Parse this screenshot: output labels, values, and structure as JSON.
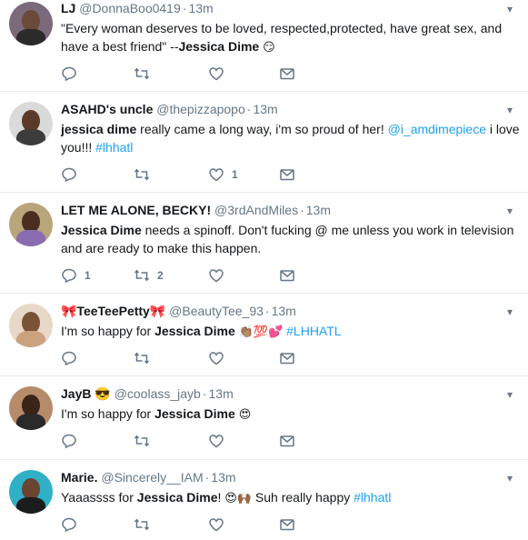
{
  "tweets": [
    {
      "name": "LJ",
      "handle": "@DonnaBoo0419",
      "time": "13m",
      "text_html": "\"Every woman deserves to be loved, respected,protected, have great sex, and have a best friend\" --<b>Jessica Dime</b> <span class=\"emoji\">😏</span>",
      "replies": "",
      "retweets": "",
      "likes": "",
      "avatar": {
        "bg": "#7a6a7c",
        "face": "#6b4a3a",
        "body": "#2b2b2b"
      }
    },
    {
      "name": "ASAHD's uncle",
      "handle": "@thepizzapopo",
      "time": "13m",
      "text_html": "<b>jessica dime</b> really came a long way, i'm so proud of her! <span class=\"link\">@i_amdimepiece</span> i love you!!! <span class=\"link\">#lhhatl</span>",
      "replies": "",
      "retweets": "",
      "likes": "1",
      "avatar": {
        "bg": "#dadada",
        "face": "#5a3a28",
        "body": "#3c3c3c"
      }
    },
    {
      "name": "LET ME ALONE, BECKY!",
      "handle": "@3rdAndMiles",
      "time": "13m",
      "text_html": "<b>Jessica Dime</b> needs a spinoff. Don't fucking @ me unless you work in television and are ready to make this happen.",
      "replies": "1",
      "retweets": "2",
      "likes": "",
      "avatar": {
        "bg": "#b9a57a",
        "face": "#4a2e22",
        "body": "#8a6cb0"
      }
    },
    {
      "name": "🎀TeeTeePetty🎀",
      "handle": "@BeautyTee_93",
      "time": "13m",
      "text_html": "I'm so happy for <b>Jessica Dime</b> <span class=\"emoji\">👏🏽💯💕</span> <span class=\"link\">#LHHATL</span>",
      "replies": "",
      "retweets": "",
      "likes": "",
      "avatar": {
        "bg": "#e8d8c8",
        "face": "#7a5236",
        "body": "#caa27e"
      }
    },
    {
      "name": "JayB 😎",
      "handle": "@coolass_jayb",
      "time": "13m",
      "text_html": "I'm so happy for <b>Jessica Dime</b> <span class=\"emoji\">😍</span>",
      "replies": "",
      "retweets": "",
      "likes": "",
      "avatar": {
        "bg": "#b78b6a",
        "face": "#3a2418",
        "body": "#2a2a2a"
      }
    },
    {
      "name": "Marie.",
      "handle": "@Sincerely__IAM",
      "time": "13m",
      "text_html": "Yaaassss for <b>Jessica Dime</b>! <span class=\"emoji\">😍🙌🏾</span> Suh really happy <span class=\"link\">#lhhatl</span>",
      "replies": "",
      "retweets": "",
      "likes": "",
      "avatar": {
        "bg": "#2fb0c6",
        "face": "#6a4430",
        "body": "#1c1c1c"
      }
    }
  ]
}
